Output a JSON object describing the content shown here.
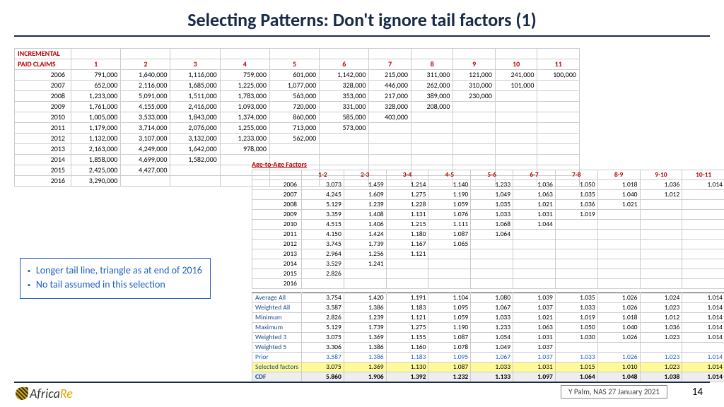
{
  "title": "Selecting Patterns: Don't ignore tail factors (1)",
  "inc": {
    "header": "INCREMENTAL PAID CLAIMS",
    "cols": [
      "1",
      "2",
      "3",
      "4",
      "5",
      "6",
      "7",
      "8",
      "9",
      "10",
      "11"
    ],
    "rows": [
      {
        "y": "2006",
        "v": [
          "791,000",
          "1,640,000",
          "1,116,000",
          "759,000",
          "601,000",
          "1,142,000",
          "215,000",
          "311,000",
          "121,000",
          "241,000",
          "100,000"
        ]
      },
      {
        "y": "2007",
        "v": [
          "652,000",
          "2,116,000",
          "1,685,000",
          "1,225,000",
          "1,077,000",
          "328,000",
          "446,000",
          "262,000",
          "310,000",
          "101,000",
          ""
        ]
      },
      {
        "y": "2008",
        "v": [
          "1,233,000",
          "5,091,000",
          "1,511,000",
          "1,783,000",
          "563,000",
          "353,000",
          "217,000",
          "389,000",
          "230,000",
          "",
          ""
        ]
      },
      {
        "y": "2009",
        "v": [
          "1,761,000",
          "4,155,000",
          "2,416,000",
          "1,093,000",
          "720,000",
          "331,000",
          "328,000",
          "208,000",
          "",
          "",
          ""
        ]
      },
      {
        "y": "2010",
        "v": [
          "1,005,000",
          "3,533,000",
          "1,843,000",
          "1,374,000",
          "860,000",
          "585,000",
          "403,000",
          "",
          "",
          "",
          ""
        ]
      },
      {
        "y": "2011",
        "v": [
          "1,179,000",
          "3,714,000",
          "2,076,000",
          "1,255,000",
          "713,000",
          "573,000",
          "",
          "",
          "",
          "",
          ""
        ]
      },
      {
        "y": "2012",
        "v": [
          "1,132,000",
          "3,107,000",
          "3,132,000",
          "1,233,000",
          "562,000",
          "",
          "",
          "",
          "",
          "",
          ""
        ]
      },
      {
        "y": "2013",
        "v": [
          "2,163,000",
          "4,249,000",
          "1,642,000",
          "978,000",
          "",
          "",
          "",
          "",
          "",
          "",
          ""
        ]
      },
      {
        "y": "2014",
        "v": [
          "1,858,000",
          "4,699,000",
          "1,582,000",
          "",
          "",
          "",
          "",
          "",
          "",
          "",
          ""
        ]
      },
      {
        "y": "2015",
        "v": [
          "2,425,000",
          "4,427,000",
          "",
          "",
          "",
          "",
          "",
          "",
          "",
          "",
          ""
        ]
      },
      {
        "y": "2016",
        "v": [
          "3,290,000",
          "",
          "",
          "",
          "",
          "",
          "",
          "",
          "",
          "",
          ""
        ]
      }
    ]
  },
  "ata": {
    "title": "Age-to-Age Factors",
    "cols": [
      "1-2",
      "2-3",
      "3-4",
      "4-5",
      "5-6",
      "6-7",
      "7-8",
      "8-9",
      "9-10",
      "10-11"
    ],
    "rows": [
      {
        "y": "2006",
        "v": [
          "3.073",
          "1.459",
          "1.214",
          "1.140",
          "1.233",
          "1.036",
          "1.050",
          "1.018",
          "1.036",
          "1.014"
        ]
      },
      {
        "y": "2007",
        "v": [
          "4.245",
          "1.609",
          "1.275",
          "1.190",
          "1.049",
          "1.063",
          "1.035",
          "1.040",
          "1.012",
          ""
        ]
      },
      {
        "y": "2008",
        "v": [
          "5.129",
          "1.239",
          "1.228",
          "1.059",
          "1.035",
          "1.021",
          "1.036",
          "1.021",
          "",
          ""
        ]
      },
      {
        "y": "2009",
        "v": [
          "3.359",
          "1.408",
          "1.131",
          "1.076",
          "1.033",
          "1.031",
          "1.019",
          "",
          "",
          ""
        ]
      },
      {
        "y": "2010",
        "v": [
          "4.515",
          "1.406",
          "1.215",
          "1.111",
          "1.068",
          "1.044",
          "",
          "",
          "",
          ""
        ]
      },
      {
        "y": "2011",
        "v": [
          "4.150",
          "1.424",
          "1.180",
          "1.087",
          "1.064",
          "",
          "",
          "",
          "",
          ""
        ]
      },
      {
        "y": "2012",
        "v": [
          "3.745",
          "1.739",
          "1.167",
          "1.065",
          "",
          "",
          "",
          "",
          "",
          ""
        ]
      },
      {
        "y": "2013",
        "v": [
          "2.964",
          "1.256",
          "1.121",
          "",
          "",
          "",
          "",
          "",
          "",
          ""
        ]
      },
      {
        "y": "2014",
        "v": [
          "3.529",
          "1.241",
          "",
          "",
          "",
          "",
          "",
          "",
          "",
          ""
        ]
      },
      {
        "y": "2015",
        "v": [
          "2.826",
          "",
          "",
          "",
          "",
          "",
          "",
          "",
          "",
          ""
        ]
      },
      {
        "y": "2016",
        "v": [
          "",
          "",
          "",
          "",
          "",
          "",
          "",
          "",
          "",
          ""
        ]
      }
    ],
    "stats": [
      {
        "l": "Average All",
        "v": [
          "3.754",
          "1.420",
          "1.191",
          "1.104",
          "1.080",
          "1.039",
          "1.035",
          "1.026",
          "1.024",
          "1.014"
        ],
        "c": "sec top-b"
      },
      {
        "l": "Weighted All",
        "v": [
          "3.587",
          "1.386",
          "1.183",
          "1.095",
          "1.067",
          "1.037",
          "1.033",
          "1.026",
          "1.023",
          "1.014"
        ],
        "c": ""
      },
      {
        "l": "Minimum",
        "v": [
          "2.826",
          "1.239",
          "1.121",
          "1.059",
          "1.033",
          "1.021",
          "1.019",
          "1.018",
          "1.012",
          "1.014"
        ],
        "c": ""
      },
      {
        "l": "Maximum",
        "v": [
          "5.129",
          "1.739",
          "1.275",
          "1.190",
          "1.233",
          "1.063",
          "1.050",
          "1.040",
          "1.036",
          "1.014"
        ],
        "c": ""
      },
      {
        "l": "Weighted 3",
        "v": [
          "3.075",
          "1.369",
          "1.155",
          "1.087",
          "1.054",
          "1.031",
          "1.030",
          "1.026",
          "1.023",
          "1.014"
        ],
        "c": ""
      },
      {
        "l": "Weighted 5",
        "v": [
          "3.306",
          "1.386",
          "1.160",
          "1.078",
          "1.049",
          "1.037",
          "",
          "",
          "",
          ""
        ],
        "c": ""
      },
      {
        "l": "Prior",
        "v": [
          "3.587",
          "1.386",
          "1.183",
          "1.095",
          "1.067",
          "1.037",
          "1.033",
          "1.026",
          "1.023",
          "1.014"
        ],
        "c": "prior top-b"
      },
      {
        "l": "Selected factors",
        "v": [
          "3.075",
          "1.369",
          "1.130",
          "1.087",
          "1.033",
          "1.031",
          "1.015",
          "1.010",
          "1.023",
          "1.014"
        ],
        "c": "sel"
      },
      {
        "l": "CDF",
        "v": [
          "5.860",
          "1.906",
          "1.392",
          "1.232",
          "1.133",
          "1.097",
          "1.064",
          "1.048",
          "1.038",
          "1.014"
        ],
        "c": "cdf top-b"
      }
    ]
  },
  "callout": {
    "b1": "Longer tail line, triangle as at end of 2016",
    "b2": "No tail assumed in this selection"
  },
  "footer": {
    "logo1": "Africa",
    "logo2": "Re",
    "credit": "Y Palm, NAS 27 January 2021",
    "page": "14"
  }
}
